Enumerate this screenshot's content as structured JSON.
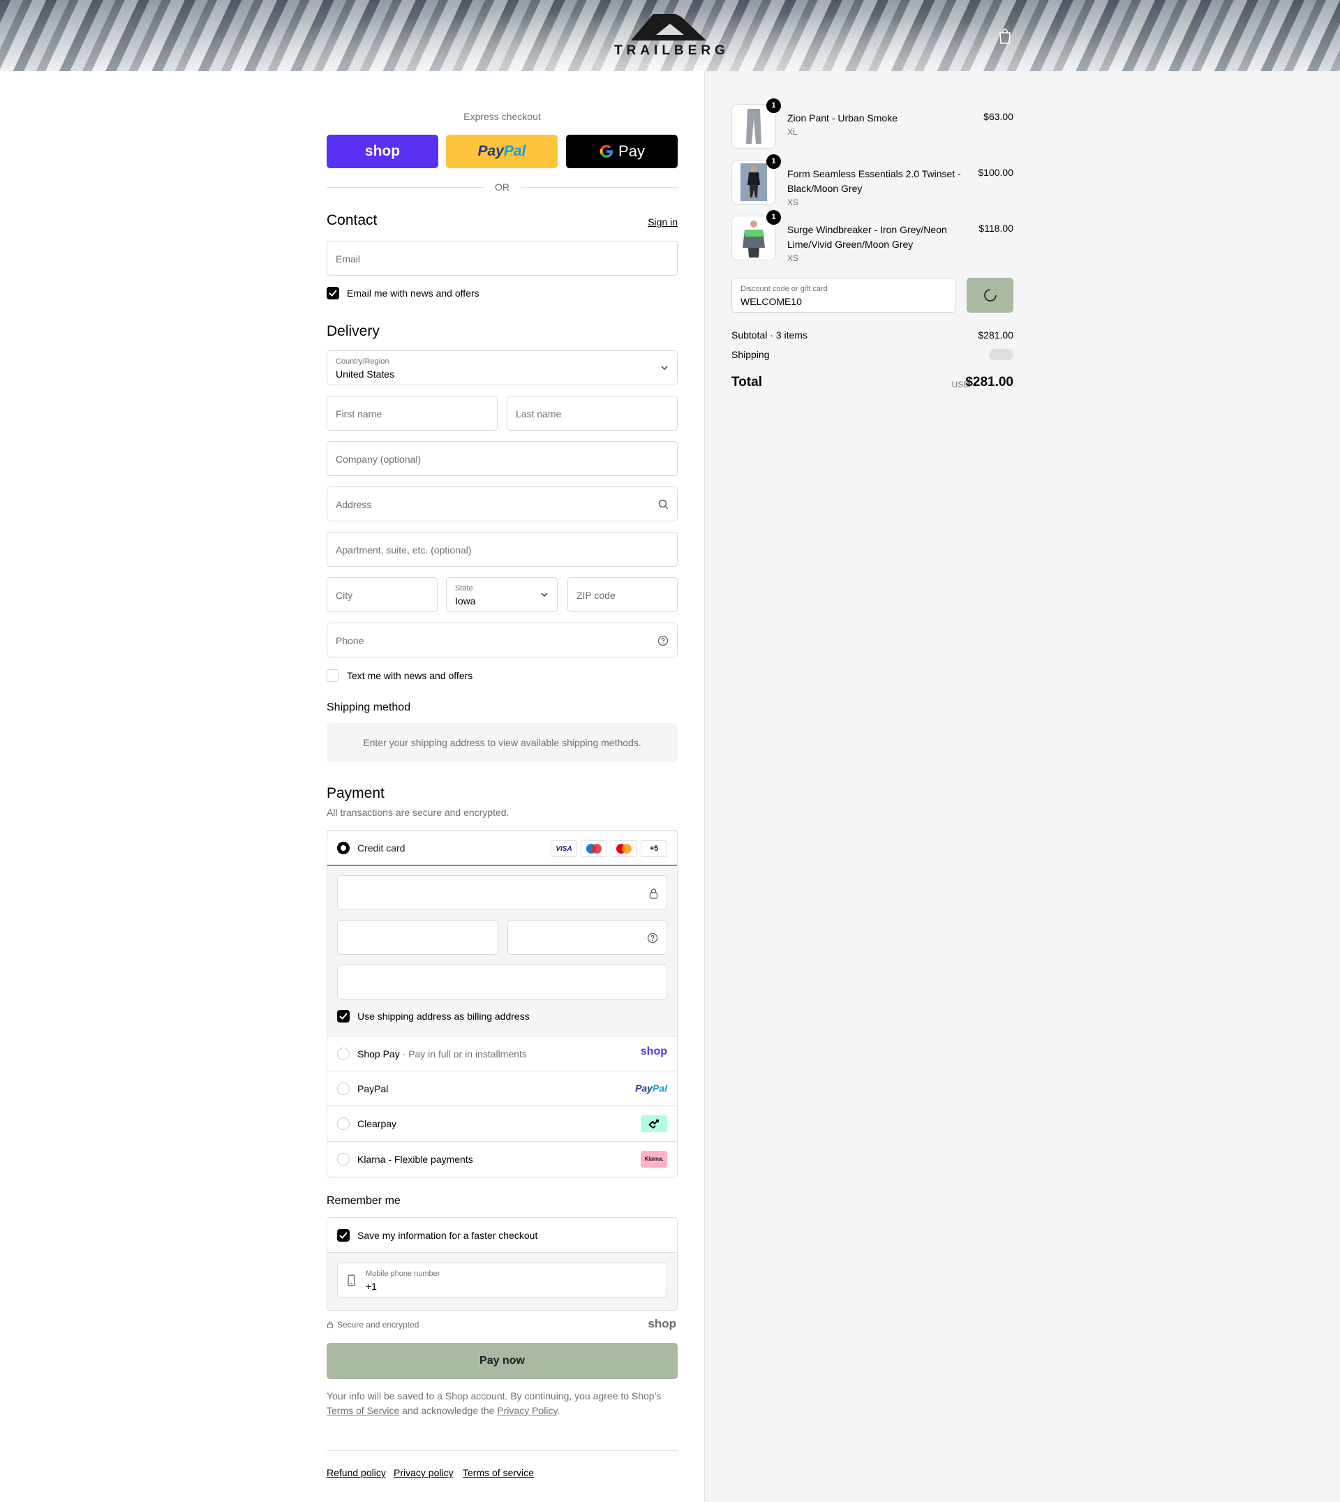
{
  "brand": {
    "name": "TRAILBERG"
  },
  "express": {
    "label": "Express checkout",
    "shop": "shop",
    "paypal_a": "Pay",
    "paypal_b": "Pal",
    "gpay": "Pay",
    "or": "OR"
  },
  "contact": {
    "title": "Contact",
    "sign_in": "Sign in",
    "email_placeholder": "Email",
    "news_label": "Email me with news and offers"
  },
  "delivery": {
    "title": "Delivery",
    "country_label": "Country/Region",
    "country_value": "United States",
    "first_name": "First name",
    "last_name": "Last name",
    "company": "Company (optional)",
    "address": "Address",
    "apartment": "Apartment, suite, etc. (optional)",
    "city": "City",
    "state_label": "State",
    "state_value": "Iowa",
    "zip": "ZIP code",
    "phone": "Phone",
    "text_label": "Text me with news and offers"
  },
  "shipping_method": {
    "title": "Shipping method",
    "note": "Enter your shipping address to view available shipping methods."
  },
  "payment": {
    "title": "Payment",
    "subtitle": "All transactions are secure and encrypted.",
    "credit_card": "Credit card",
    "card_more": "+5",
    "visa": "VISA",
    "billing_label": "Use shipping address as billing address",
    "shop_pay": "Shop Pay",
    "shop_pay_sep": "·",
    "shop_pay_desc": "Pay in full or in installments",
    "shop_brand": "shop",
    "paypal": "PayPal",
    "paypal_brand_a": "Pay",
    "paypal_brand_b": "Pal",
    "clearpay": "Clearpay",
    "klarna": "Klarna - Flexible payments",
    "klarna_brand": "Klarna."
  },
  "remember": {
    "title": "Remember me",
    "save_label": "Save my information for a faster checkout",
    "mobile_label": "Mobile phone number",
    "mobile_value": "+1",
    "secure": "Secure and encrypted",
    "shop_brand": "shop"
  },
  "pay_now": "Pay now",
  "legal": {
    "text1": "Your info will be saved to a Shop account. By continuing, you agree to Shop’s",
    "tos": "Terms of Service",
    "text2": "and acknowledge the",
    "privacy": "Privacy Policy",
    "period": "."
  },
  "footer": {
    "refund": "Refund policy",
    "privacy": "Privacy policy",
    "terms": "Terms of service"
  },
  "order": {
    "items": [
      {
        "title": "Zion Pant - Urban Smoke",
        "variant": "XL",
        "price": "$63.00",
        "qty": "1"
      },
      {
        "title": "Form Seamless Essentials 2.0 Twinset - Black/Moon Grey",
        "variant": "XS",
        "price": "$100.00",
        "qty": "1"
      },
      {
        "title": "Surge Windbreaker - Iron Grey/Neon Lime/Vivid Green/Moon Grey",
        "variant": "XS",
        "price": "$118.00",
        "qty": "1"
      }
    ],
    "discount_label": "Discount code or gift card",
    "discount_value": "WELCOME10",
    "subtotal_label": "Subtotal · 3 items",
    "subtotal_value": "$281.00",
    "shipping_label": "Shipping",
    "total_label": "Total",
    "currency": "USD",
    "total_value": "$281.00"
  },
  "colors": {
    "shop": "#5a31f4",
    "paypal": "#ffc439",
    "gpay": "#000000",
    "pay_now": "#a9b9a2",
    "clearpay": "#b2fce4",
    "klarna": "#ffb3c7"
  }
}
